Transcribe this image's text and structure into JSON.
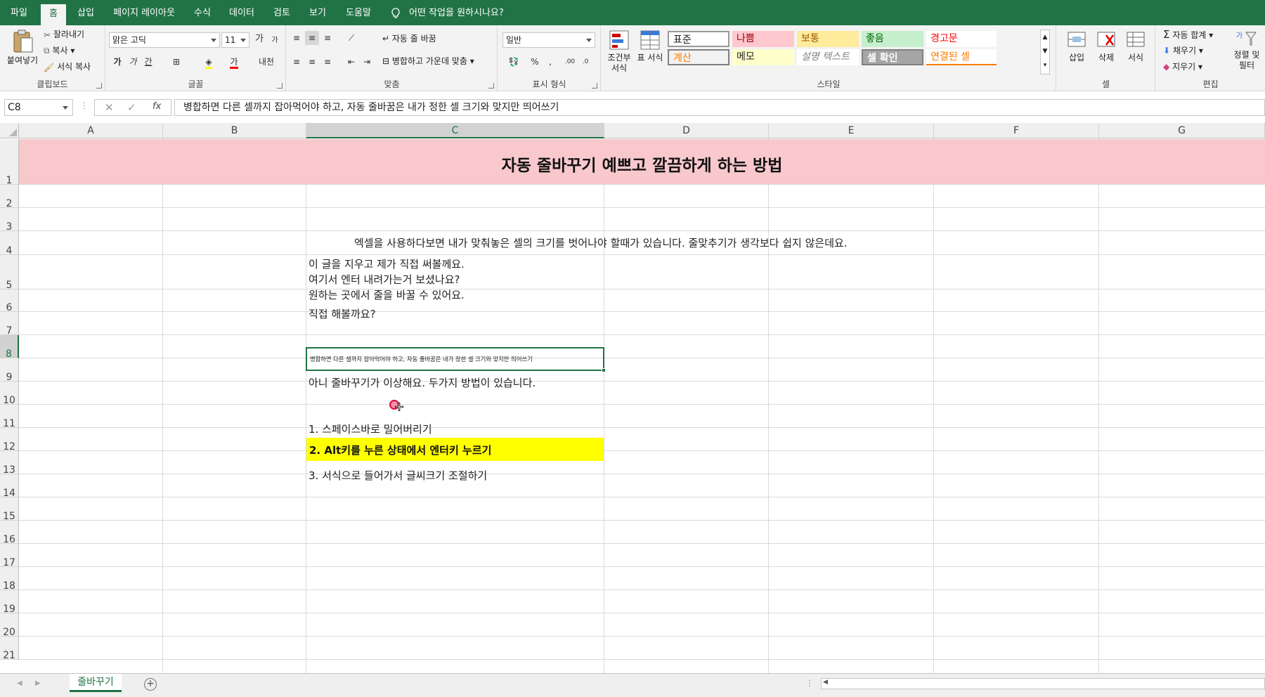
{
  "menu": {
    "tabs": [
      "파일",
      "홈",
      "삽입",
      "페이지 레이아웃",
      "수식",
      "데이터",
      "검토",
      "보기",
      "도움말"
    ],
    "active": "홈",
    "tell_me": "어떤 작업을 원하시나요?"
  },
  "ribbon": {
    "clipboard": {
      "label": "클립보드",
      "paste": "붙여넣기",
      "cut": "잘라내기",
      "copy": "복사",
      "format_painter": "서식 복사"
    },
    "font": {
      "label": "글꼴",
      "name": "맑은 고딕",
      "size": "11",
      "grow": "가",
      "shrink": "가",
      "bold": "가",
      "italic": "가",
      "underline": "간",
      "font_color": "가",
      "phonetic": "내천"
    },
    "alignment": {
      "label": "맞춤",
      "wrap_text": "자동 줄 바꿈",
      "merge_center": "병합하고 가운데 맞춤"
    },
    "number": {
      "label": "표시 형식",
      "format": "일반",
      "percent": "%",
      "comma": ","
    },
    "styles": {
      "label": "스타일",
      "conditional": "조건부 서식",
      "format_table": "표 서식",
      "cells": [
        {
          "text": "표준",
          "bg": "#ffffff",
          "color": "#222222"
        },
        {
          "text": "나쁨",
          "bg": "#ffc7ce",
          "color": "#9c0006"
        },
        {
          "text": "보통",
          "bg": "#ffeb9c",
          "color": "#9c5700"
        },
        {
          "text": "좋음",
          "bg": "#c6efce",
          "color": "#006100"
        },
        {
          "text": "경고문",
          "bg": "#ffffff",
          "color": "#ff0000"
        },
        {
          "text": "계산",
          "bg": "#f2f2f2",
          "color": "#fa7d00"
        },
        {
          "text": "메모",
          "bg": "#ffffcc",
          "color": "#222222"
        },
        {
          "text": "설명 텍스트",
          "bg": "#ffffff",
          "color": "#7f7f7f"
        },
        {
          "text": "셀 확인",
          "bg": "#a5a5a5",
          "color": "#ffffff"
        },
        {
          "text": "연결된 셀",
          "bg": "#ffffff",
          "color": "#fa7d00"
        }
      ]
    },
    "cells": {
      "label": "셀",
      "insert": "삽입",
      "delete": "삭제",
      "format": "서식"
    },
    "editing": {
      "label": "편집",
      "autosum": "자동 합계",
      "fill": "채우기",
      "clear": "지우기",
      "sort_filter": "정렬 및 필터"
    }
  },
  "formula_bar": {
    "name_box": "C8",
    "fx": "fx",
    "content": "병합하면 다른 셀까지 잡아먹어야 하고, 자동 줄바꿈은 내가 정한 셀 크기와 맞지만 띄어쓰기"
  },
  "grid": {
    "columns": [
      "A",
      "B",
      "C",
      "D",
      "E",
      "F",
      "G"
    ],
    "rows": [
      "1",
      "2",
      "3",
      "4",
      "5",
      "6",
      "7",
      "8",
      "9",
      "10",
      "11",
      "12",
      "13",
      "14",
      "15",
      "16",
      "17",
      "18",
      "19",
      "20",
      "21"
    ],
    "selected_col": "C",
    "selected_row": "8",
    "title": "자동 줄바꾸기 예쁘고 깔끔하게 하는 방법",
    "r4": "엑셀을 사용하다보면 내가 맞춰놓은 셀의 크기를 벗어나야 할때가 있습니다. 줄맞추기가 생각보다 쉽지 않은데요.",
    "r5": [
      "이 글을 지우고 제가 직접 써볼께요.",
      "여기서 엔터 내려가는거 보셨나요?",
      "원하는 곳에서 줄을 바꿀 수 있어요."
    ],
    "r6": "직접 해볼까요?",
    "r8": "병합하면 다른 셀까지 잡아먹어야 하고, 자동 줄바꿈은 내가 정한 셀 크기와 맞지만 띄어쓰기",
    "r9": "아니 줄바꾸기가 이상해요. 두가지 방법이 있습니다.",
    "r11": "1. 스페이스바로 밀어버리기",
    "r12": "2. Alt키를 누른 상태에서 엔터키 누르기",
    "r13": "3. 서식으로 들어가서 글씨크기 조절하기",
    "colors": {
      "title_bg": "#f8c8cc",
      "highlight_bg": "#ffff00",
      "accent": "#217346"
    }
  },
  "sheets": {
    "active": "줄바꾸기"
  }
}
